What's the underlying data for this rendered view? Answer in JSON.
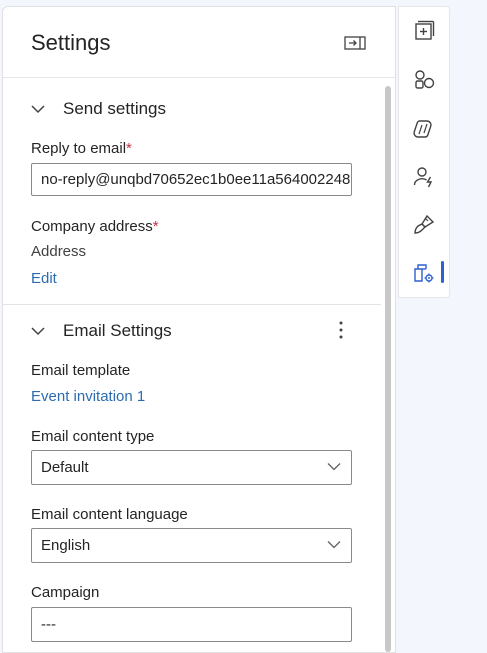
{
  "panel": {
    "title": "Settings",
    "send_settings": {
      "title": "Send settings",
      "reply_to_label": "Reply to email",
      "reply_to_value": "no-reply@unqbd70652ec1b0ee11a564002248",
      "company_address_label": "Company address",
      "company_address_value": "Address",
      "edit_label": "Edit"
    },
    "email_settings": {
      "title": "Email Settings",
      "template_label": "Email template",
      "template_value": "Event invitation 1",
      "content_type_label": "Email content type",
      "content_type_value": "Default",
      "content_language_label": "Email content language",
      "content_language_value": "English",
      "campaign_label": "Campaign",
      "campaign_value": "---"
    },
    "required_marker": "*"
  },
  "rail": {
    "items": [
      {
        "icon": "add-element-icon"
      },
      {
        "icon": "shapes-icon"
      },
      {
        "icon": "copilot-icon"
      },
      {
        "icon": "personalization-icon"
      },
      {
        "icon": "paintbrush-icon"
      },
      {
        "icon": "settings-panel-icon",
        "active": true
      }
    ]
  },
  "colors": {
    "accent": "#2f5fd0",
    "link": "#2b6cb0",
    "required": "#c4314b"
  }
}
